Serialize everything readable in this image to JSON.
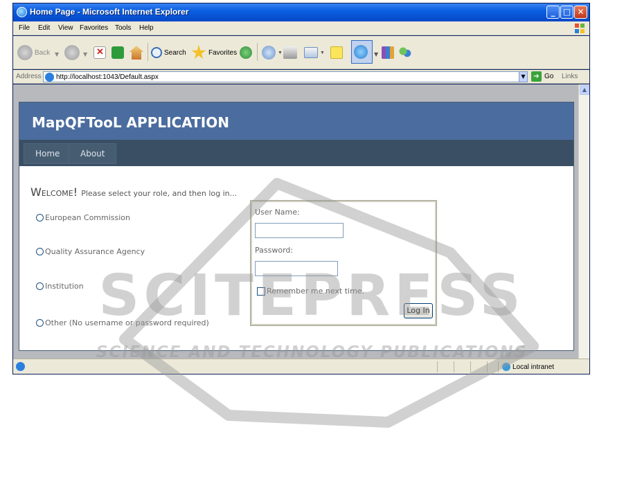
{
  "window": {
    "title": "Home Page - Microsoft Internet Explorer"
  },
  "menu": [
    "File",
    "Edit",
    "View",
    "Favorites",
    "Tools",
    "Help"
  ],
  "toolbar": {
    "back": "Back",
    "search": "Search",
    "favorites": "Favorites"
  },
  "address": {
    "label": "Address",
    "url": "http://localhost:1043/Default.aspx",
    "go": "Go",
    "links": "Links"
  },
  "page": {
    "app_title": "MapQFTooL APPLICATION",
    "nav": [
      "Home",
      "About"
    ],
    "welcome_big": "Welcome!",
    "welcome_text": "Please select your role, and then log in...",
    "roles": [
      "European Commission",
      "Quality Assurance Agency",
      "Institution",
      "Other  (No username or password required)"
    ]
  },
  "login": {
    "username_label": "User Name:",
    "password_label": "Password:",
    "remember": "Remember me next time.",
    "button": "Log In"
  },
  "status": {
    "zone": "Local intranet"
  },
  "watermark": {
    "title": "SCITEPRESS",
    "subtitle": "SCIENCE AND TECHNOLOGY PUBLICATIONS"
  }
}
